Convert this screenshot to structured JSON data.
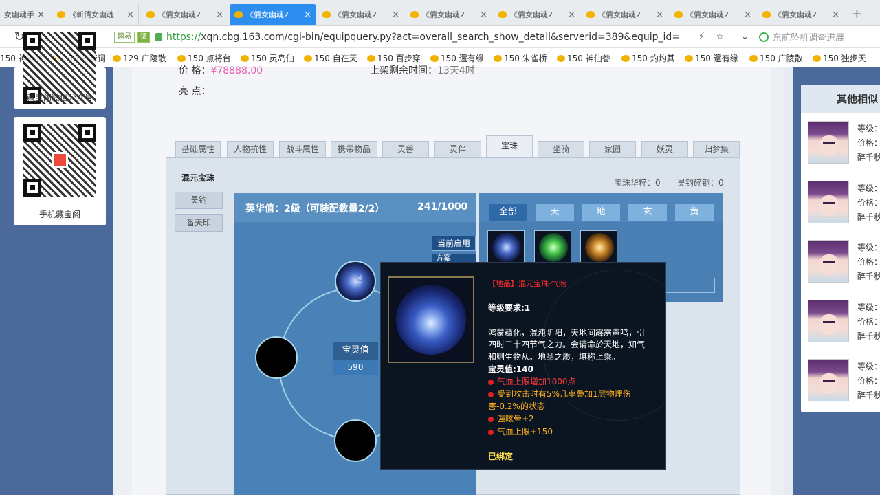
{
  "browser": {
    "tabs": [
      {
        "label": "女幽魂手"
      },
      {
        "label": "《新倩女幽魂"
      },
      {
        "label": "《倩女幽魂2"
      },
      {
        "label": "《倩女幽魂2"
      },
      {
        "label": "《倩女幽魂2"
      },
      {
        "label": "《倩女幽魂2"
      },
      {
        "label": "《倩女幽魂2"
      },
      {
        "label": "《倩女幽魂2"
      },
      {
        "label": "《倩女幽魂2"
      },
      {
        "label": "《倩女幽魂2"
      }
    ],
    "close_glyph": "×",
    "new_tab_glyph": "+",
    "url_scheme": "https://",
    "url_rest": "xqn.cbg.163.com/cgi-bin/equipquery.py?act=overall_search_show_detail&serverid=389&equip_id=",
    "badge_wy": "网易",
    "badge_ok": "证",
    "search_hint": "东航坠机调查进展",
    "bookmarks": [
      "150 神雕侠",
      "150 兰若词",
      "129 广陵散",
      "150 点将台",
      "150 灵岛仙",
      "150 自在天",
      "150 百步穿",
      "150 還有缘",
      "150 朱雀桥",
      "150 神仙眷",
      "150 灼灼其",
      "150 還有缘",
      "150 广陵散",
      "150 独步天"
    ]
  },
  "left": {
    "qr1_caption": "藏宝阁微信公众号",
    "qr2_caption": "手机藏宝阁"
  },
  "detail": {
    "price_label": "价   格：",
    "price_value": "¥78888.00",
    "time_label": "上架剩余时间：",
    "time_value": "13天4时",
    "highlight_label": "亮   点：",
    "tabs": [
      "基础属性",
      "人物抗性",
      "战斗属性",
      "携带物品",
      "灵兽",
      "灵伴",
      "宝珠",
      "坐骑",
      "家园",
      "妖灵",
      "归梦集"
    ],
    "side_tabs": [
      "混元宝珠",
      "昊钩",
      "番天印"
    ],
    "stat_huacui": "宝珠华粹：0",
    "stat_suitong": "昊钩碎铜：0",
    "yinghua": "英华值：2级（可装配数量2/2）",
    "yinghua_progress": "241/1000",
    "enabled_btn": "当前启用",
    "scheme_btn": "方案",
    "lingzhi_title": "宝灵值",
    "lingzhi_value": "590",
    "filter_tabs": [
      "全部",
      "天",
      "地",
      "玄",
      "黄"
    ]
  },
  "tooltip": {
    "title": "【地品】混元宝珠·气泡",
    "level_req": "等级要求:1",
    "desc_lines": [
      "鸿蒙蕴化，混沌阴阳，天地间霹雳声鸣，引",
      "四时二十四节气之力。会请命於天地，知气",
      "和则生物从。地品之质，堪称上乘。"
    ],
    "lingzhi": "宝灵值:140",
    "attrs": [
      {
        "text": "气血上限增加1000点",
        "color": "#ff3a3a"
      },
      {
        "text": "受到攻击时有5%几率叠加1层物理伤",
        "color": "#ffb020"
      },
      {
        "text": "害-0.2%的状态",
        "color": "#ffb020",
        "nodot": true
      },
      {
        "text": "强眩晕+2",
        "color": "#ffb020"
      },
      {
        "text": "气血上限+150",
        "color": "#ffb020"
      }
    ],
    "bound": "已绑定"
  },
  "similar": {
    "header": "其他相似",
    "items": [
      {
        "level": "等级：",
        "price": "价格：",
        "server": "醉千秋"
      },
      {
        "level": "等级：",
        "price": "价格：",
        "server": "醉千秋"
      },
      {
        "level": "等级：",
        "price": "价格：",
        "server": "醉千秋"
      },
      {
        "level": "等级：",
        "price": "价格：",
        "server": "醉千秋"
      },
      {
        "level": "等级：",
        "price": "价格：",
        "server": "醉千秋"
      }
    ]
  }
}
